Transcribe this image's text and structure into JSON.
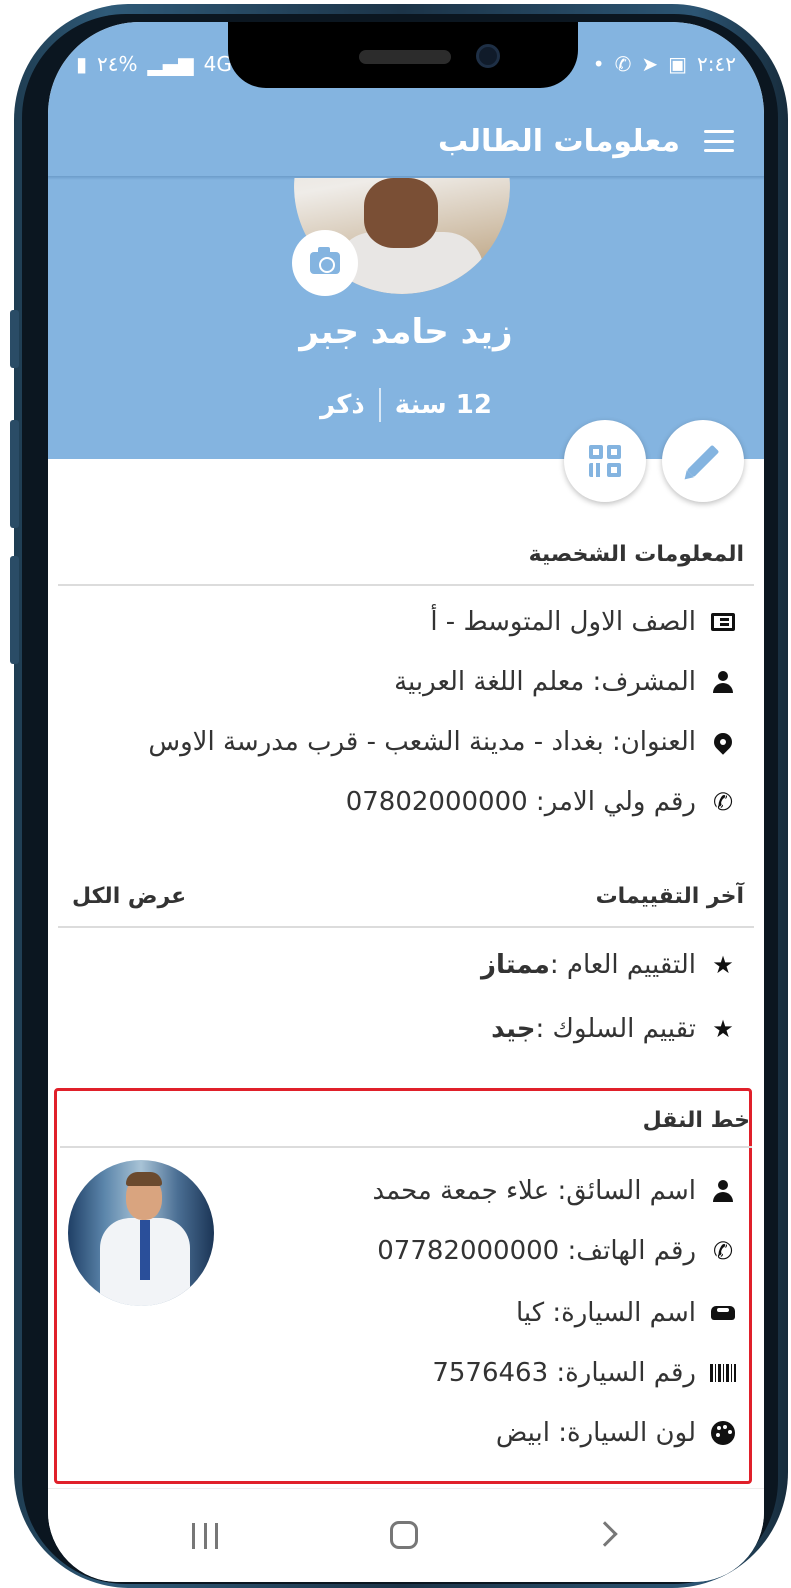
{
  "status_bar": {
    "battery": "٢٤%",
    "network": "4G",
    "time": "٢:٤٢"
  },
  "app_bar": {
    "title": "معلومات الطالب",
    "menu_icon": "hamburger-menu-icon"
  },
  "student": {
    "name": "زيد حامد جبر",
    "age": "12 سنة",
    "gender": "ذكر"
  },
  "actions": {
    "edit_icon": "pencil-icon",
    "qr_icon": "qr-code-icon",
    "camera_icon": "camera-icon"
  },
  "personal_info": {
    "title": "المعلومات الشخصية",
    "rows": [
      {
        "icon": "classroom-icon",
        "text": "الصف الاول المتوسط - أ"
      },
      {
        "icon": "supervisor-icon",
        "text": "المشرف: معلم اللغة العربية"
      },
      {
        "icon": "location-pin-icon",
        "text": "العنوان: بغداد - مدينة الشعب - قرب مدرسة الاوس"
      },
      {
        "icon": "phone-icon",
        "text": "رقم ولي الامر: 07802000000"
      }
    ]
  },
  "evaluations": {
    "title": "آخر التقييمات",
    "view_all": "عرض الكل",
    "rows": [
      {
        "icon": "star-icon",
        "label": "التقييم العام : ",
        "value": "ممتاز"
      },
      {
        "icon": "star-icon",
        "label": "تقييم السلوك : ",
        "value": "جيد"
      }
    ]
  },
  "transport": {
    "title": "خط النقل",
    "rows": [
      {
        "icon": "person-icon",
        "text": "اسم السائق: علاء جمعة محمد"
      },
      {
        "icon": "phone-icon",
        "text": "رقم الهاتف: 07782000000"
      },
      {
        "icon": "car-icon",
        "text": "اسم السيارة: كيا"
      },
      {
        "icon": "barcode-icon",
        "text": "رقم السيارة: 7576463"
      },
      {
        "icon": "palette-icon",
        "text": "لون السيارة: ابيض"
      }
    ]
  },
  "colors": {
    "header": "#84b4e0",
    "highlight_border": "#e0202a",
    "text": "#333333"
  }
}
